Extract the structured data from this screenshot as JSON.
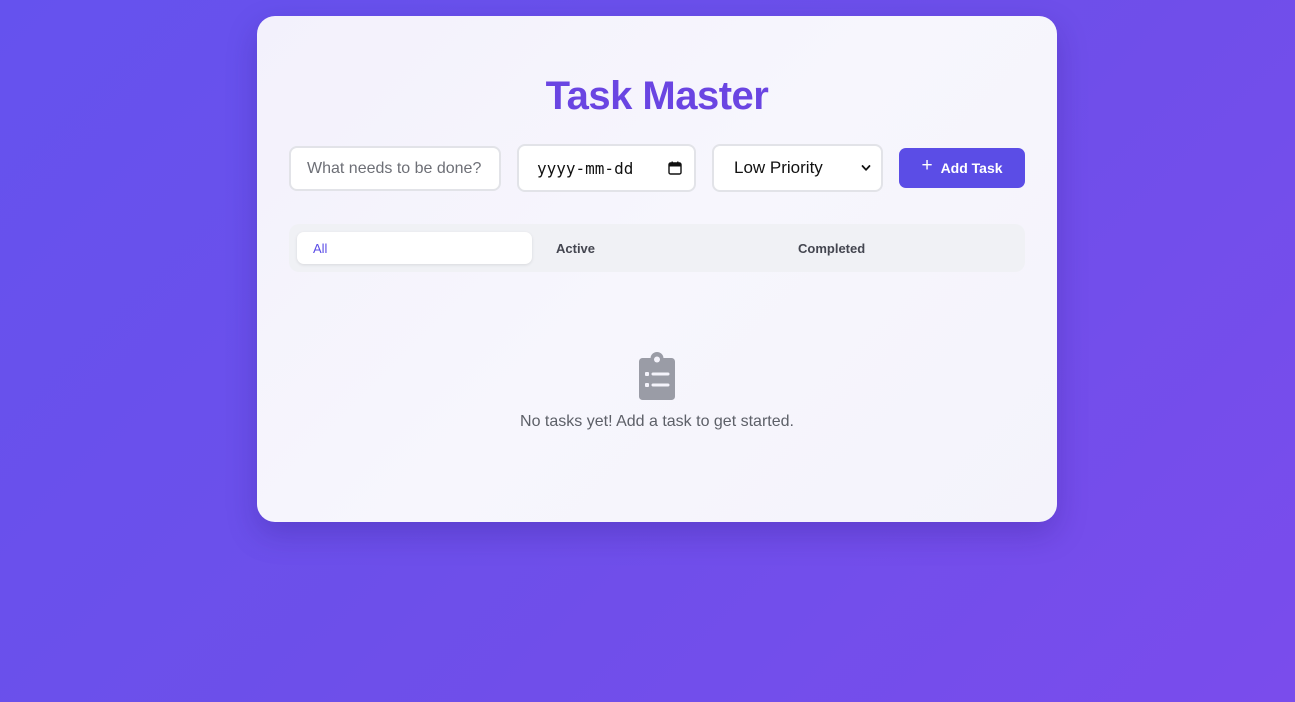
{
  "app": {
    "title": "Task Master"
  },
  "form": {
    "task_placeholder": "What needs to be done?",
    "task_value": "",
    "date_placeholder": "yyyy-mm-dd",
    "date_icon": "calendar-icon",
    "priority_selected": "Low Priority",
    "priority_icon": "chevron-down-icon",
    "add_label": "Add Task",
    "add_icon": "plus-icon"
  },
  "filters": {
    "selected": "All",
    "tabs": [
      {
        "label": "All"
      },
      {
        "label": "Active"
      },
      {
        "label": "Completed"
      }
    ]
  },
  "empty_state": {
    "icon": "clipboard-list-icon",
    "message": "No tasks yet! Add a task to get started."
  },
  "colors": {
    "accent": "#5b4de6",
    "title": "#6a45e2",
    "background_start": "#6552ee",
    "background_end": "#7a4cec",
    "icon_gray": "#9a9ca6"
  }
}
